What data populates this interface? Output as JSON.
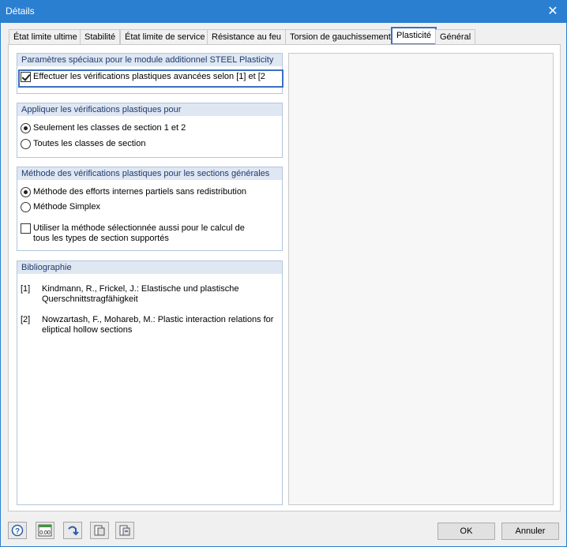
{
  "window": {
    "title": "Détails",
    "close_glyph": "✕"
  },
  "tabs": [
    {
      "label": "État limite ultime"
    },
    {
      "label": "Stabilité"
    },
    {
      "label": "État limite de service"
    },
    {
      "label": "Résistance au feu"
    },
    {
      "label": "Torsion de gauchissement"
    },
    {
      "label": "Plasticité",
      "active": true
    },
    {
      "label": "Général"
    }
  ],
  "group_steel": {
    "header": "Paramètres spéciaux pour le module additionnel STEEL Plasticity",
    "checkbox_label": "Effectuer les vérifications plastiques avancées selon [1] et [2",
    "checked": true
  },
  "group_apply": {
    "header": "Appliquer les vérifications plastiques pour",
    "options": [
      {
        "label": "Seulement les classes de section 1 et 2",
        "selected": true
      },
      {
        "label": "Toutes les classes de section",
        "selected": false
      }
    ]
  },
  "group_method": {
    "header": "Méthode des vérifications plastiques pour les sections générales",
    "options": [
      {
        "label": "Méthode des efforts internes partiels sans redistribution",
        "selected": true
      },
      {
        "label": "Méthode Simplex",
        "selected": false
      }
    ],
    "checkbox_label": "Utiliser la méthode sélectionnée aussi pour le calcul de tous les types de section supportés",
    "checked": false
  },
  "group_bib": {
    "header": "Bibliographie",
    "entries": [
      {
        "num": "[1]",
        "text": "Kindmann, R., Frickel, J.: Elastische und plastische Querschnittstragfähigkeit"
      },
      {
        "num": "[2]",
        "text": "Nowzartash, F., Mohareb, M.: Plastic interaction relations for eliptical hollow sections"
      }
    ]
  },
  "bottom_icons": [
    {
      "name": "help-icon"
    },
    {
      "name": "decimal-places-icon",
      "text": "0.00"
    },
    {
      "name": "reset-arrow-icon"
    },
    {
      "name": "export-settings-icon"
    },
    {
      "name": "import-settings-icon"
    }
  ],
  "buttons": {
    "ok": "OK",
    "cancel": "Annuler"
  },
  "colors": {
    "accent": "#2b7fd0",
    "focus": "#3c6fc1",
    "group_header_bg": "#dfe7f2",
    "group_header_text": "#1e3a6e"
  }
}
